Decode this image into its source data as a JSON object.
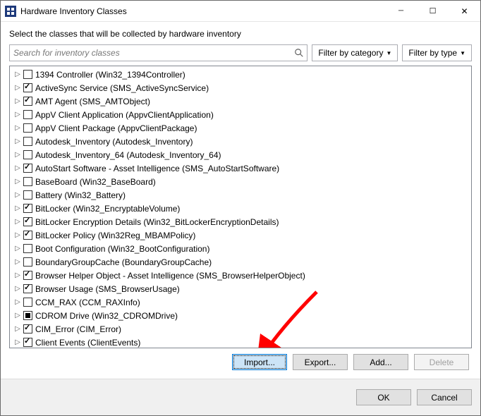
{
  "titlebar": {
    "title": "Hardware Inventory Classes"
  },
  "instruction": "Select the classes that will be collected by hardware inventory",
  "search": {
    "placeholder": "Search for inventory classes"
  },
  "filters": {
    "category_label": "Filter by category",
    "type_label": "Filter by type"
  },
  "classes": [
    {
      "label": "1394 Controller (Win32_1394Controller)",
      "state": "unchecked"
    },
    {
      "label": "ActiveSync Service (SMS_ActiveSyncService)",
      "state": "checked"
    },
    {
      "label": "AMT Agent (SMS_AMTObject)",
      "state": "checked"
    },
    {
      "label": "AppV Client Application (AppvClientApplication)",
      "state": "unchecked"
    },
    {
      "label": "AppV Client Package (AppvClientPackage)",
      "state": "unchecked"
    },
    {
      "label": "Autodesk_Inventory (Autodesk_Inventory)",
      "state": "unchecked"
    },
    {
      "label": "Autodesk_Inventory_64 (Autodesk_Inventory_64)",
      "state": "unchecked"
    },
    {
      "label": "AutoStart Software - Asset Intelligence (SMS_AutoStartSoftware)",
      "state": "checked"
    },
    {
      "label": "BaseBoard (Win32_BaseBoard)",
      "state": "unchecked"
    },
    {
      "label": "Battery (Win32_Battery)",
      "state": "unchecked"
    },
    {
      "label": "BitLocker (Win32_EncryptableVolume)",
      "state": "checked"
    },
    {
      "label": "BitLocker Encryption Details (Win32_BitLockerEncryptionDetails)",
      "state": "checked"
    },
    {
      "label": "BitLocker Policy (Win32Reg_MBAMPolicy)",
      "state": "checked"
    },
    {
      "label": "Boot Configuration (Win32_BootConfiguration)",
      "state": "unchecked"
    },
    {
      "label": "BoundaryGroupCache (BoundaryGroupCache)",
      "state": "unchecked"
    },
    {
      "label": "Browser Helper Object - Asset Intelligence (SMS_BrowserHelperObject)",
      "state": "checked"
    },
    {
      "label": "Browser Usage (SMS_BrowserUsage)",
      "state": "checked"
    },
    {
      "label": "CCM_RAX (CCM_RAXInfo)",
      "state": "unchecked"
    },
    {
      "label": "CDROM Drive (Win32_CDROMDrive)",
      "state": "indeterminate"
    },
    {
      "label": "CIM_Error (CIM_Error)",
      "state": "checked"
    },
    {
      "label": "Client Events (ClientEvents)",
      "state": "checked"
    }
  ],
  "action_buttons": {
    "import": "Import...",
    "export": "Export...",
    "add": "Add...",
    "delete": "Delete"
  },
  "dialog_buttons": {
    "ok": "OK",
    "cancel": "Cancel"
  }
}
